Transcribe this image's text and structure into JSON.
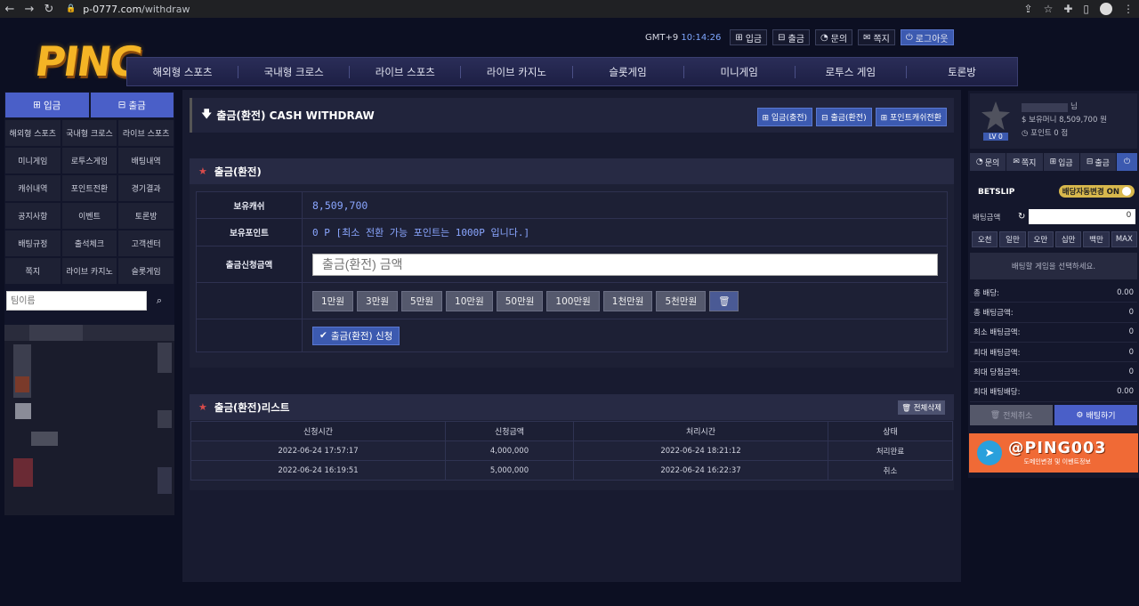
{
  "browser": {
    "url_host": "p-0777.com",
    "url_path": "/withdraw"
  },
  "logo": {
    "text": "PING"
  },
  "topbar": {
    "tz": "GMT+9",
    "time": "10:14:26",
    "deposit": "입금",
    "withdraw": "출금",
    "inquiry": "문의",
    "message": "쪽지",
    "logout": "로그아웃"
  },
  "nav": [
    "해외형 스포츠",
    "국내형 크로스",
    "라이브 스포츠",
    "라이브 카지노",
    "슬롯게임",
    "미니게임",
    "로투스 게임",
    "토론방"
  ],
  "left": {
    "deposit": "입금",
    "withdraw": "출금",
    "grid": [
      "해외형 스포츠",
      "국내형 크로스",
      "라이브 스포츠",
      "미니게임",
      "로투스게임",
      "배팅내역",
      "캐쉬내역",
      "포인트전환",
      "경기결과",
      "공지사항",
      "이벤트",
      "토론방",
      "배팅규정",
      "출석체크",
      "고객센터",
      "쪽지",
      "라이브 카지노",
      "슬롯게임"
    ],
    "search_placeholder": "팀이름"
  },
  "page": {
    "title": "출금(환전) CASH WITHDRAW",
    "actions": [
      "입금(충전)",
      "출금(환전)",
      "포인트캐쉬전환"
    ]
  },
  "withdraw": {
    "section_title": "출금(환전)",
    "cash_label": "보유캐쉬",
    "cash_value": "8,509,700",
    "point_label": "보유포인트",
    "point_value": "0 P [최소 전환 가능 포인트는 1000P 입니다.]",
    "amount_label": "출금신청금액",
    "amount_placeholder": "출금(환전) 금액",
    "amount_buttons": [
      "1만원",
      "3만원",
      "5만원",
      "10만원",
      "50만원",
      "100만원",
      "1천만원",
      "5천만원"
    ],
    "submit": "출금(환전) 신청"
  },
  "list": {
    "title": "출금(환전)리스트",
    "delete_all": "전체삭제",
    "columns": [
      "신청시간",
      "신청금액",
      "처리시간",
      "상태"
    ],
    "rows": [
      [
        "2022-06-24 17:57:17",
        "4,000,000",
        "2022-06-24 18:21:12",
        "처리완료"
      ],
      [
        "2022-06-24 16:19:51",
        "5,000,000",
        "2022-06-24 16:22:37",
        "취소"
      ]
    ]
  },
  "right": {
    "level": "LV 0",
    "name_suffix": "님",
    "money_label": "보유머니",
    "money_value": "8,509,700 원",
    "point_label": "포인트",
    "point_value": "0 점",
    "buttons": [
      "문의",
      "쪽지",
      "입금",
      "출금"
    ],
    "betslip": "BETSLIP",
    "auto_toggle": "배당자동변경 ON",
    "bet_amount_label": "배팅금액",
    "bet_amount_value": "0",
    "chips": [
      "오천",
      "일만",
      "오만",
      "십만",
      "백만",
      "MAX"
    ],
    "select_msg": "배팅할 게임을 선택하세요.",
    "summary": [
      [
        "총 배당:",
        "0.00"
      ],
      [
        "총 배팅금액:",
        "0"
      ],
      [
        "최소 배팅금액:",
        "0"
      ],
      [
        "최대 배팅금액:",
        "0"
      ],
      [
        "최대 당첨금액:",
        "0"
      ],
      [
        "최대 배팅배당:",
        "0.00"
      ]
    ],
    "cancel_all": "전체취소",
    "bet": "배팅하기"
  },
  "banner": {
    "handle": "@PING003",
    "sub": "도메인변경 및 이벤트정보"
  }
}
